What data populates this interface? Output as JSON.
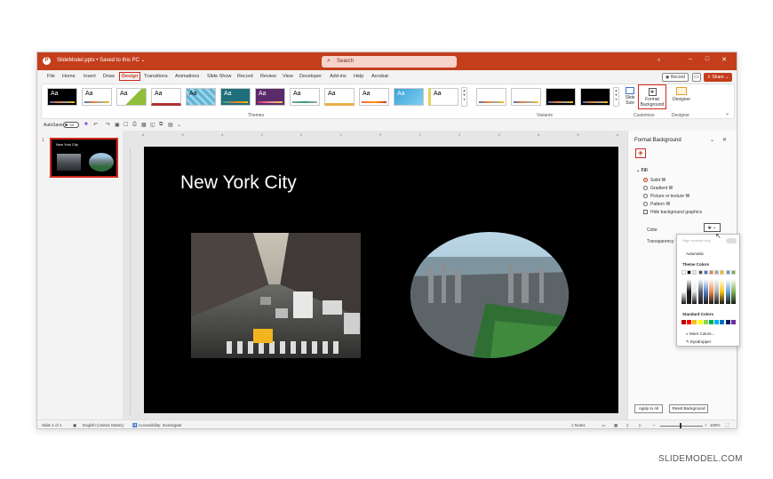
{
  "titlebar": {
    "file_title": "SlideModel.pptx • Saved to this PC ⌄",
    "search_placeholder": "Search"
  },
  "tabs": [
    "File",
    "Home",
    "Insert",
    "Draw",
    "Design",
    "Transitions",
    "Animations",
    "Slide Show",
    "Record",
    "Review",
    "View",
    "Developer",
    "Add-ins",
    "Help",
    "Acrobat"
  ],
  "tabs_right": {
    "record": "Record",
    "share": "Share"
  },
  "ribbon": {
    "theme_label": "Aa",
    "groups": {
      "themes": "Themes",
      "variants": "Variants",
      "customize": "Customize",
      "designer": "Designer"
    },
    "slide_size": "Slide Size",
    "format_background": "Format Background",
    "designer_btn": "Designer"
  },
  "qat": {
    "autosave": "AutoSave",
    "toggle": "Off"
  },
  "thumbnail": {
    "number": "1",
    "title": "New York City"
  },
  "slide": {
    "title": "New York City"
  },
  "ruler_marks": [
    "6",
    "5",
    "4",
    "3",
    "2",
    "1",
    "0",
    "1",
    "2",
    "3",
    "4",
    "5",
    "6"
  ],
  "format_pane": {
    "title": "Format Background",
    "fill_heading": "Fill",
    "options": [
      "Solid fill",
      "Gradient fill",
      "Picture or texture fill",
      "Pattern fill"
    ],
    "hide_graphics": "Hide background graphics",
    "color_label": "Color",
    "transparency_label": "Transparency",
    "apply_all": "Apply to All",
    "reset": "Reset Background"
  },
  "color_dropdown": {
    "high_contrast": "High contrast only",
    "automatic": "Automatic",
    "theme_colors": "Theme Colors",
    "standard_colors": "Standard Colors",
    "more_colors": "More Colors...",
    "eyedropper": "Eyedropper",
    "theme_swatches": [
      "#ffffff",
      "#000000",
      "#e7e6e6",
      "#44546a",
      "#4472c4",
      "#ed7d31",
      "#a5a5a5",
      "#ffc000",
      "#5b9bd5",
      "#70ad47"
    ],
    "standard_swatches": [
      "#c00000",
      "#ff0000",
      "#ffc000",
      "#ffff00",
      "#92d050",
      "#00b050",
      "#00b0f0",
      "#0070c0",
      "#002060",
      "#7030a0"
    ]
  },
  "statusbar": {
    "slide": "Slide 1 of 1",
    "language": "English (United States)",
    "accessibility": "Accessibility: Investigate",
    "notes": "Notes",
    "zoom": "100%"
  },
  "watermark": "SLIDEMODEL.COM"
}
